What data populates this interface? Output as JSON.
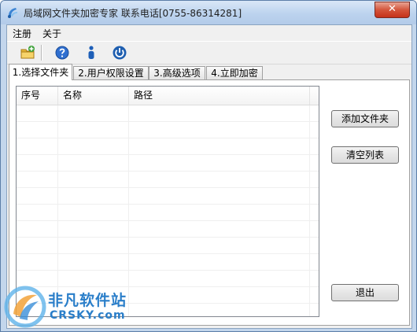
{
  "window": {
    "title": "局域网文件夹加密专家 联系电话[0755-86314281]",
    "close_glyph": "✕"
  },
  "menu": [
    {
      "label": "注册"
    },
    {
      "label": "关于"
    }
  ],
  "toolbar": {
    "buttons": [
      {
        "icon": "add-folder-icon"
      },
      {
        "icon": "help-icon"
      },
      {
        "icon": "info-icon"
      },
      {
        "icon": "power-icon"
      }
    ]
  },
  "tabs": [
    {
      "label": "1.选择文件夹",
      "active": true
    },
    {
      "label": "2.用户权限设置",
      "active": false
    },
    {
      "label": "3.高级选项",
      "active": false
    },
    {
      "label": "4.立即加密",
      "active": false
    }
  ],
  "list": {
    "columns": [
      {
        "label": "序号"
      },
      {
        "label": "名称"
      },
      {
        "label": "路径"
      }
    ],
    "rows": []
  },
  "buttons": {
    "add_folder": "添加文件夹",
    "clear_list": "清空列表",
    "exit": "退出"
  },
  "watermark": {
    "line1": "非凡软件站",
    "line2": "CRSKY.com"
  }
}
